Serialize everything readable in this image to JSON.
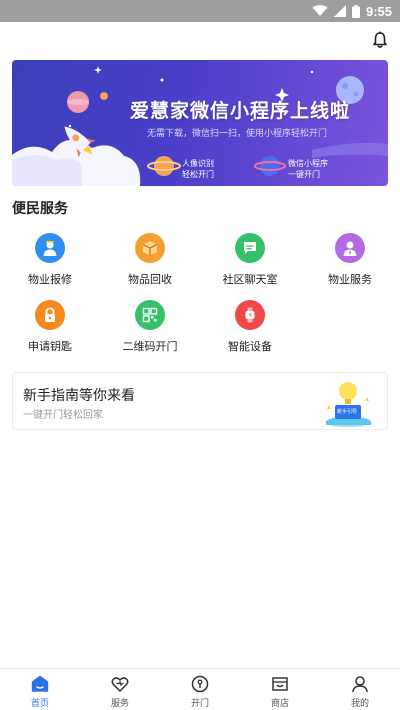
{
  "status_bar": {
    "time": "9:55",
    "icons": [
      "wifi-icon",
      "signal-icon",
      "battery-icon"
    ]
  },
  "header": {
    "notification_icon": "bell-icon"
  },
  "banner": {
    "title": "爱慧家微信小程序上线啦",
    "subtitle": "无需下载，微信扫一扫，使用小程序轻松开门",
    "feature1_line1": "人像识别",
    "feature1_line2": "轻松开门",
    "feature2_line1": "微信小程序",
    "feature2_line2": "一键开门",
    "colors": {
      "bg_start": "#3a3fb7",
      "bg_end": "#7b55db"
    }
  },
  "services": {
    "title": "便民服务",
    "items": [
      {
        "label": "物业报修",
        "icon": "repair-person-icon",
        "color": "#2e8ff0"
      },
      {
        "label": "物品回收",
        "icon": "box-icon",
        "color": "#f4a030"
      },
      {
        "label": "社区聊天室",
        "icon": "chat-bubble-icon",
        "color": "#35c16a"
      },
      {
        "label": "物业服务",
        "icon": "staff-icon",
        "color": "#b36ae2"
      },
      {
        "label": "申请钥匙",
        "icon": "lock-icon",
        "color": "#f28a1e"
      },
      {
        "label": "二维码开门",
        "icon": "qr-code-icon",
        "color": "#35c16a"
      },
      {
        "label": "智能设备",
        "icon": "smart-watch-icon",
        "color": "#ef4a4a"
      }
    ]
  },
  "guide": {
    "title": "新手指南等你来看",
    "subtitle": "一键开门轻松回家",
    "badge": "新手引导"
  },
  "tabbar": {
    "active_color": "#2b74e8",
    "tabs": [
      {
        "label": "首页",
        "icon": "home-icon",
        "active": true
      },
      {
        "label": "服务",
        "icon": "heart-icon",
        "active": false
      },
      {
        "label": "开门",
        "icon": "door-open-icon",
        "active": false
      },
      {
        "label": "商店",
        "icon": "shop-icon",
        "active": false
      },
      {
        "label": "我的",
        "icon": "user-icon",
        "active": false
      }
    ]
  }
}
